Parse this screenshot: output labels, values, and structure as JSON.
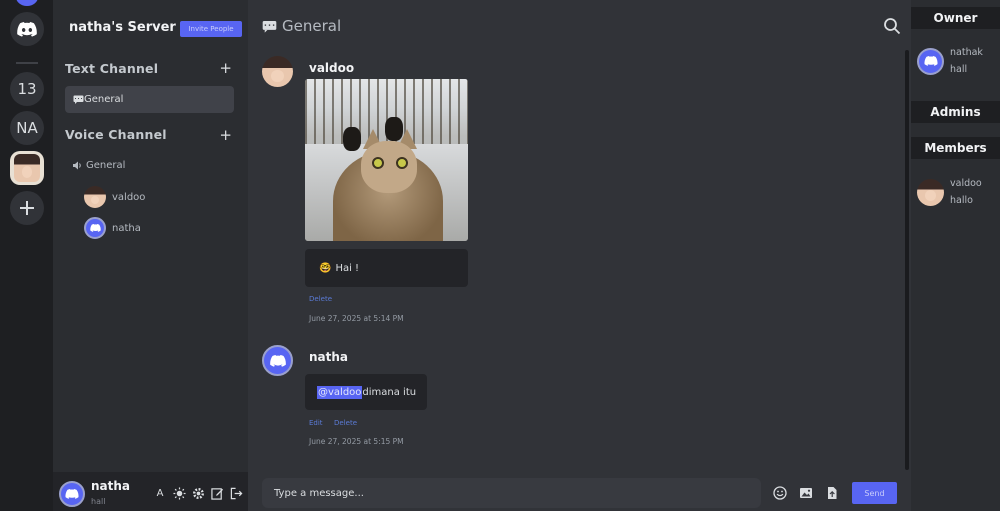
{
  "rail": {
    "count_label": "13",
    "initials_label": "NA"
  },
  "server": {
    "name": "natha's Server",
    "invite_label": "Invite People"
  },
  "sidebar": {
    "text_section": "Text Channel",
    "voice_section": "Voice Channel",
    "text_channels": [
      "General"
    ],
    "voice_channels": [
      "General"
    ],
    "voice_users": [
      "valdoo",
      "natha"
    ]
  },
  "user_panel": {
    "name": "natha",
    "status": "hall",
    "font_label": "A"
  },
  "main": {
    "channel_title": "General",
    "composer_placeholder": "Type a message...",
    "send_label": "Send"
  },
  "messages": [
    {
      "author": "valdoo",
      "text": "Hai !",
      "emoji": "🤓",
      "actions": [
        "Delete"
      ],
      "timestamp": "June 27, 2025 at 5:14 PM"
    },
    {
      "author": "natha",
      "mention": "@valdoo",
      "text": " dimana itu",
      "actions": [
        "Edit",
        "Delete"
      ],
      "timestamp": "June 27, 2025 at 5:15 PM"
    }
  ],
  "members": {
    "owner_header": "Owner",
    "admins_header": "Admins",
    "members_header": "Members",
    "owner": {
      "name": "nathak",
      "status": "hall"
    },
    "member": {
      "name": "valdoo",
      "status": "hallo"
    }
  },
  "colors": {
    "accent": "#5865f2",
    "background": "#313338",
    "sidebar": "#2b2d31",
    "rail": "#1e1f22"
  }
}
